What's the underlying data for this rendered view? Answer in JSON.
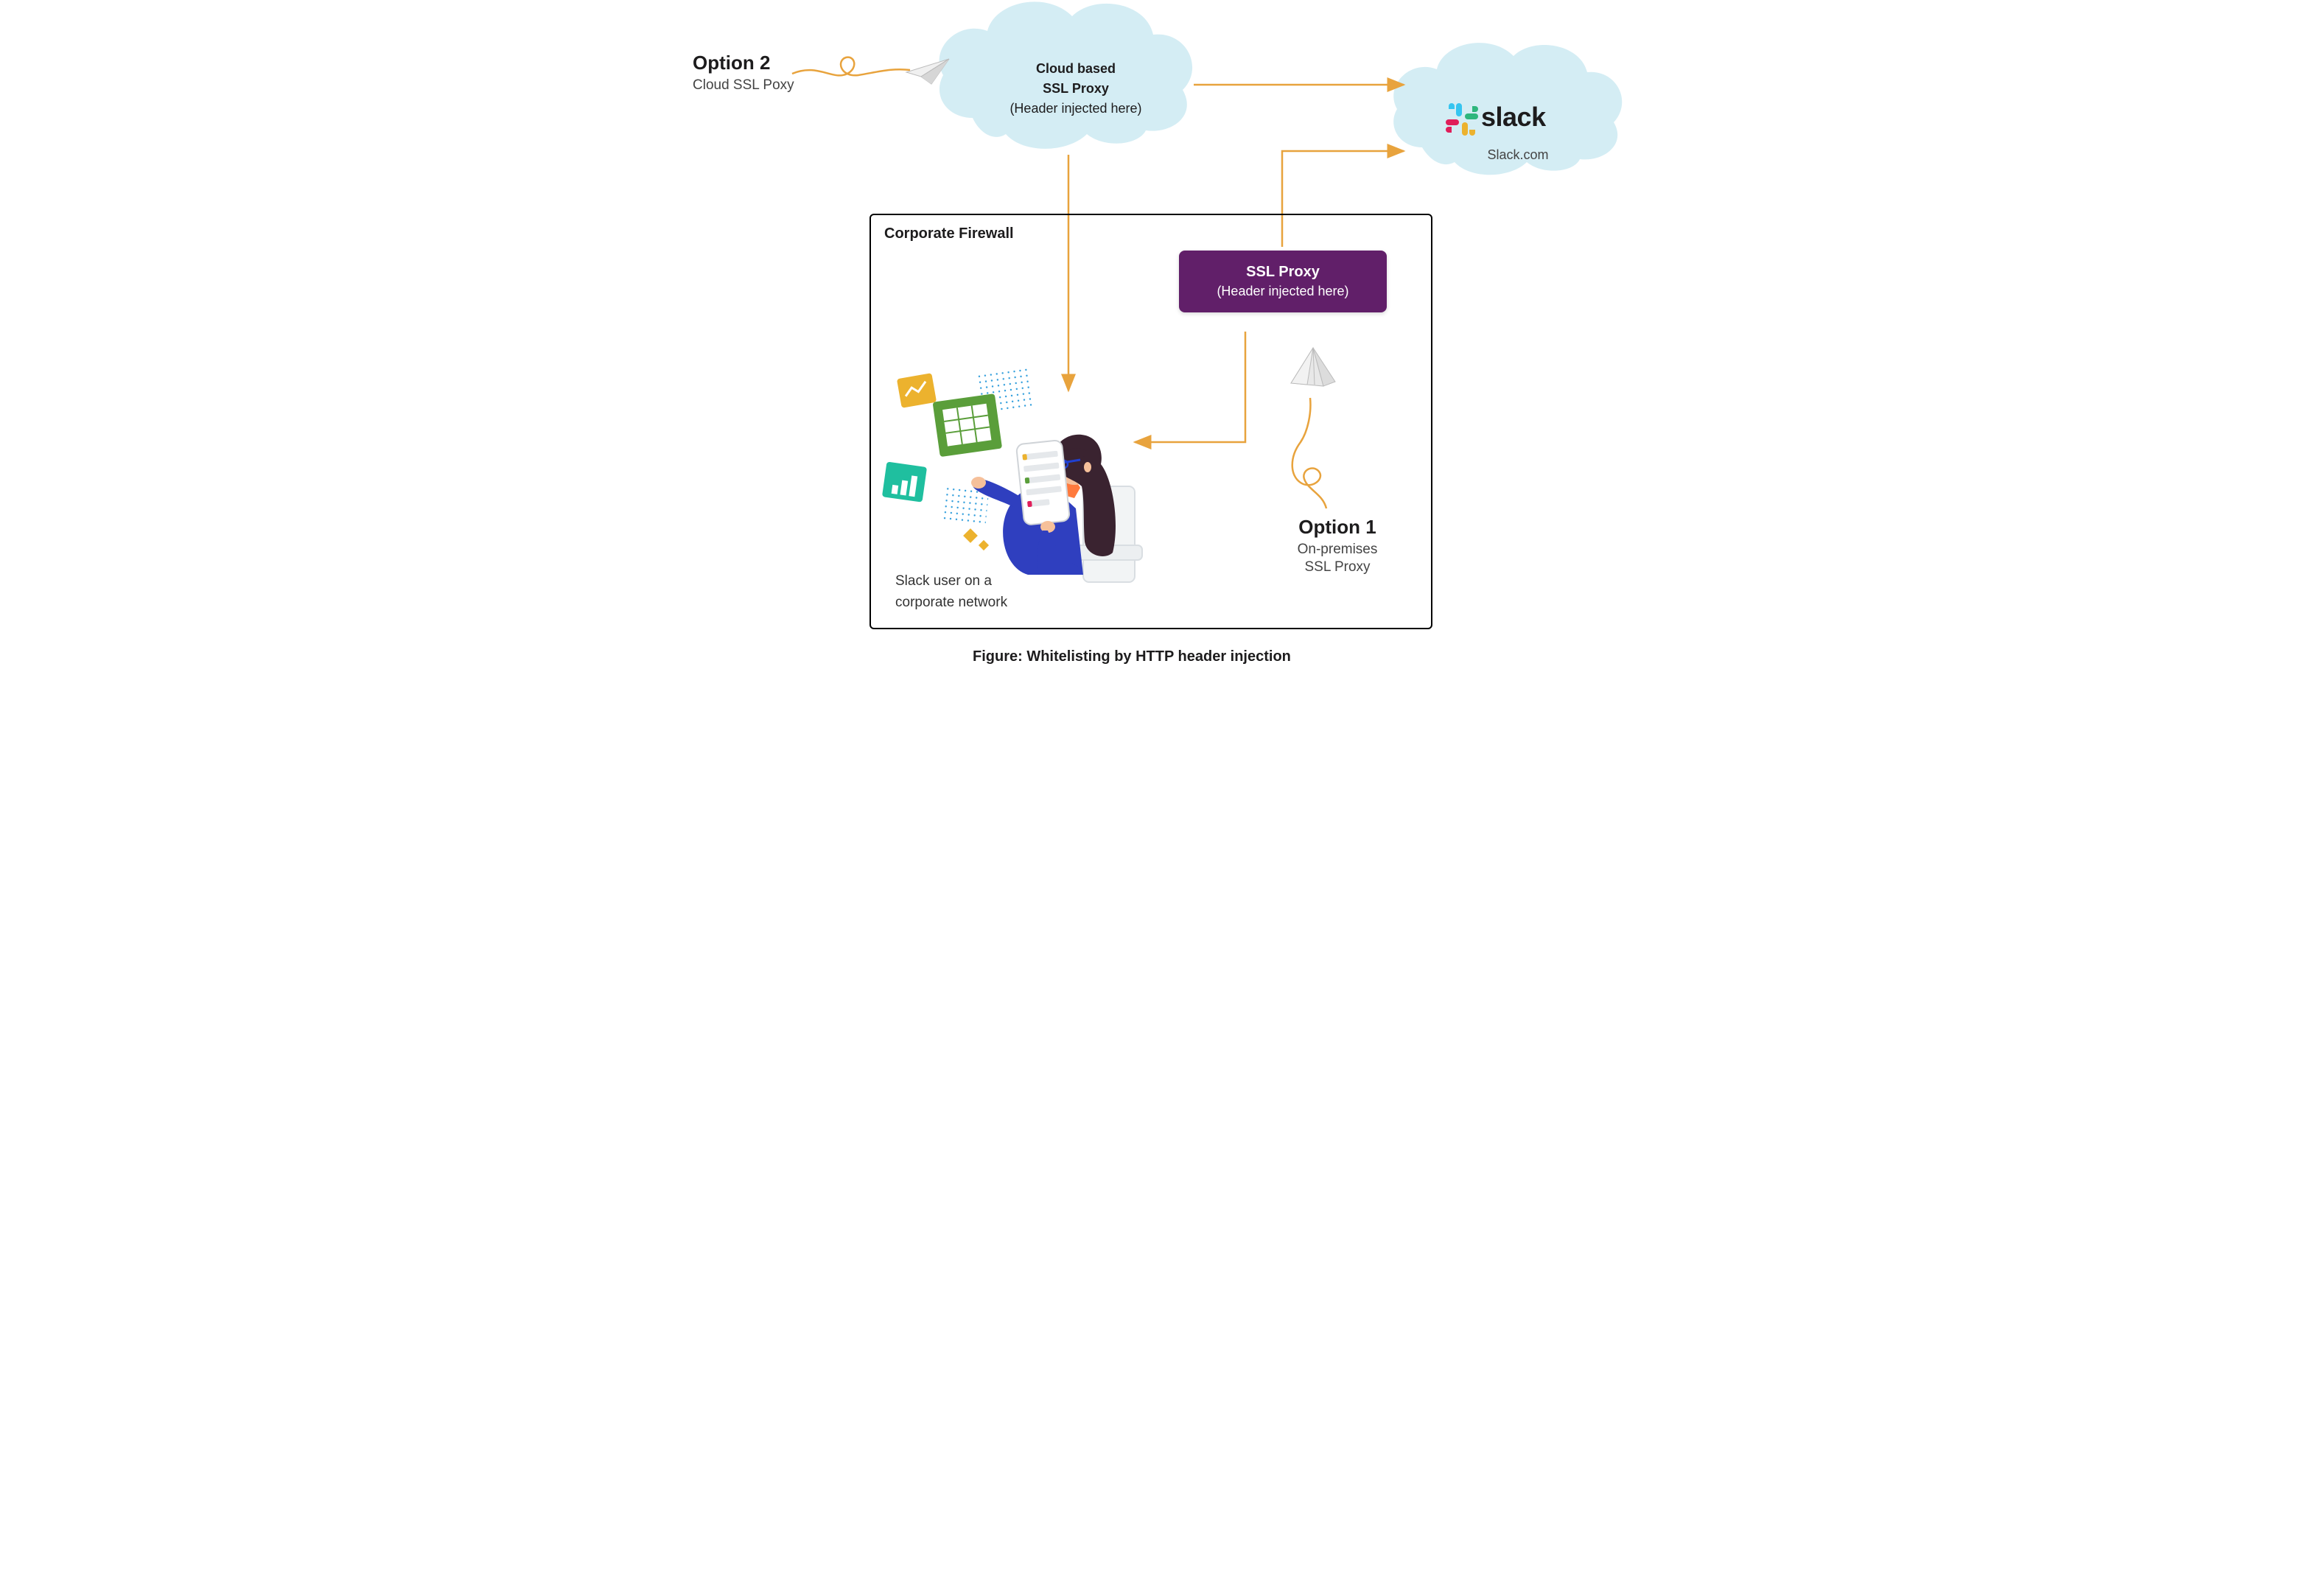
{
  "option2": {
    "title": "Option 2",
    "subtitle": "Cloud SSL Poxy"
  },
  "cloud_proxy": {
    "line1": "Cloud based",
    "line2": "SSL Proxy",
    "line3": "(Header injected here)"
  },
  "slack": {
    "name": "slack",
    "domain": "Slack.com"
  },
  "firewall": {
    "label": "Corporate Firewall"
  },
  "ssl_box": {
    "title": "SSL Proxy",
    "subtitle": "(Header injected here)"
  },
  "option1": {
    "title": "Option 1",
    "subtitle1": "On-premises",
    "subtitle2": "SSL Proxy"
  },
  "user": {
    "line1": "Slack user on a",
    "line2": "corporate network"
  },
  "caption": "Figure: Whitelisting by HTTP header injection",
  "colors": {
    "arrow": "#e8a33d",
    "cloud": "#d4edf4",
    "proxy": "#611f69"
  }
}
